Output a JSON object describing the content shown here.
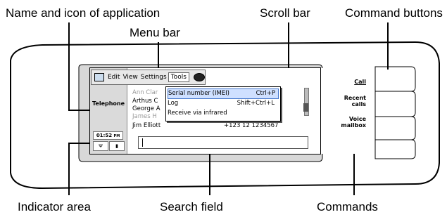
{
  "callouts": {
    "name_icon": "Name and icon of application",
    "menu_bar": "Menu bar",
    "scroll_bar": "Scroll bar",
    "command_buttons": "Command buttons",
    "indicator_area": "Indicator area",
    "search_field": "Search field",
    "commands": "Commands"
  },
  "app": {
    "name": "Telephone",
    "clock": "01:52",
    "clock_suffix": "PM",
    "indicators": [
      "Ψ",
      "▮"
    ]
  },
  "menu": {
    "items": [
      "Edit",
      "View",
      "Settings",
      "Tools"
    ],
    "selected": "Tools"
  },
  "tools_menu": [
    {
      "label": "Serial number (IMEI)",
      "shortcut": "Ctrl+P",
      "highlighted": true
    },
    {
      "label": "Log",
      "shortcut": "Shift+Ctrl+L",
      "highlighted": false
    },
    {
      "label": "Receive via infrared",
      "shortcut": "",
      "highlighted": false
    }
  ],
  "contacts": [
    {
      "name": "Ann Clar",
      "number": ""
    },
    {
      "name": "Arthus C",
      "number": ""
    },
    {
      "name": "George A",
      "number": ""
    },
    {
      "name": "James H",
      "number": ""
    },
    {
      "name": "Jim Elliott",
      "number": "+123 12 1234567"
    }
  ],
  "commands": [
    "Call",
    "Recent calls",
    "Voice mailbox"
  ],
  "search": {
    "value": ""
  }
}
